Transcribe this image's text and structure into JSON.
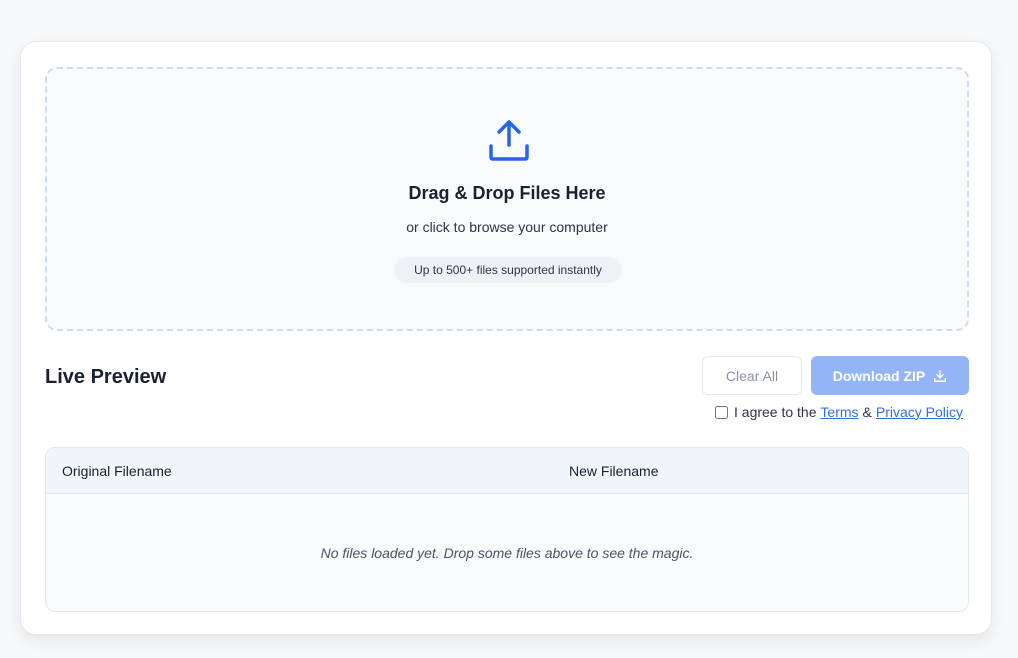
{
  "dropzone": {
    "icon": "upload-icon",
    "title": "Drag & Drop Files Here",
    "subtitle": "or click to browse your computer",
    "badge": "Up to 500+ files supported instantly"
  },
  "preview": {
    "title": "Live Preview",
    "clear_label": "Clear All",
    "download_label": "Download ZIP",
    "download_icon": "download-icon"
  },
  "agreement": {
    "prefix": "I agree to the",
    "terms": "Terms",
    "amp": "&",
    "privacy": "Privacy Policy",
    "checked": false
  },
  "table": {
    "columns": [
      "Original Filename",
      "New Filename"
    ],
    "empty_message": "No files loaded yet. Drop some files above to see the magic."
  },
  "colors": {
    "accent": "#2563eb",
    "download_button_disabled": "#93b4f5",
    "link": "#2f6fdc"
  }
}
